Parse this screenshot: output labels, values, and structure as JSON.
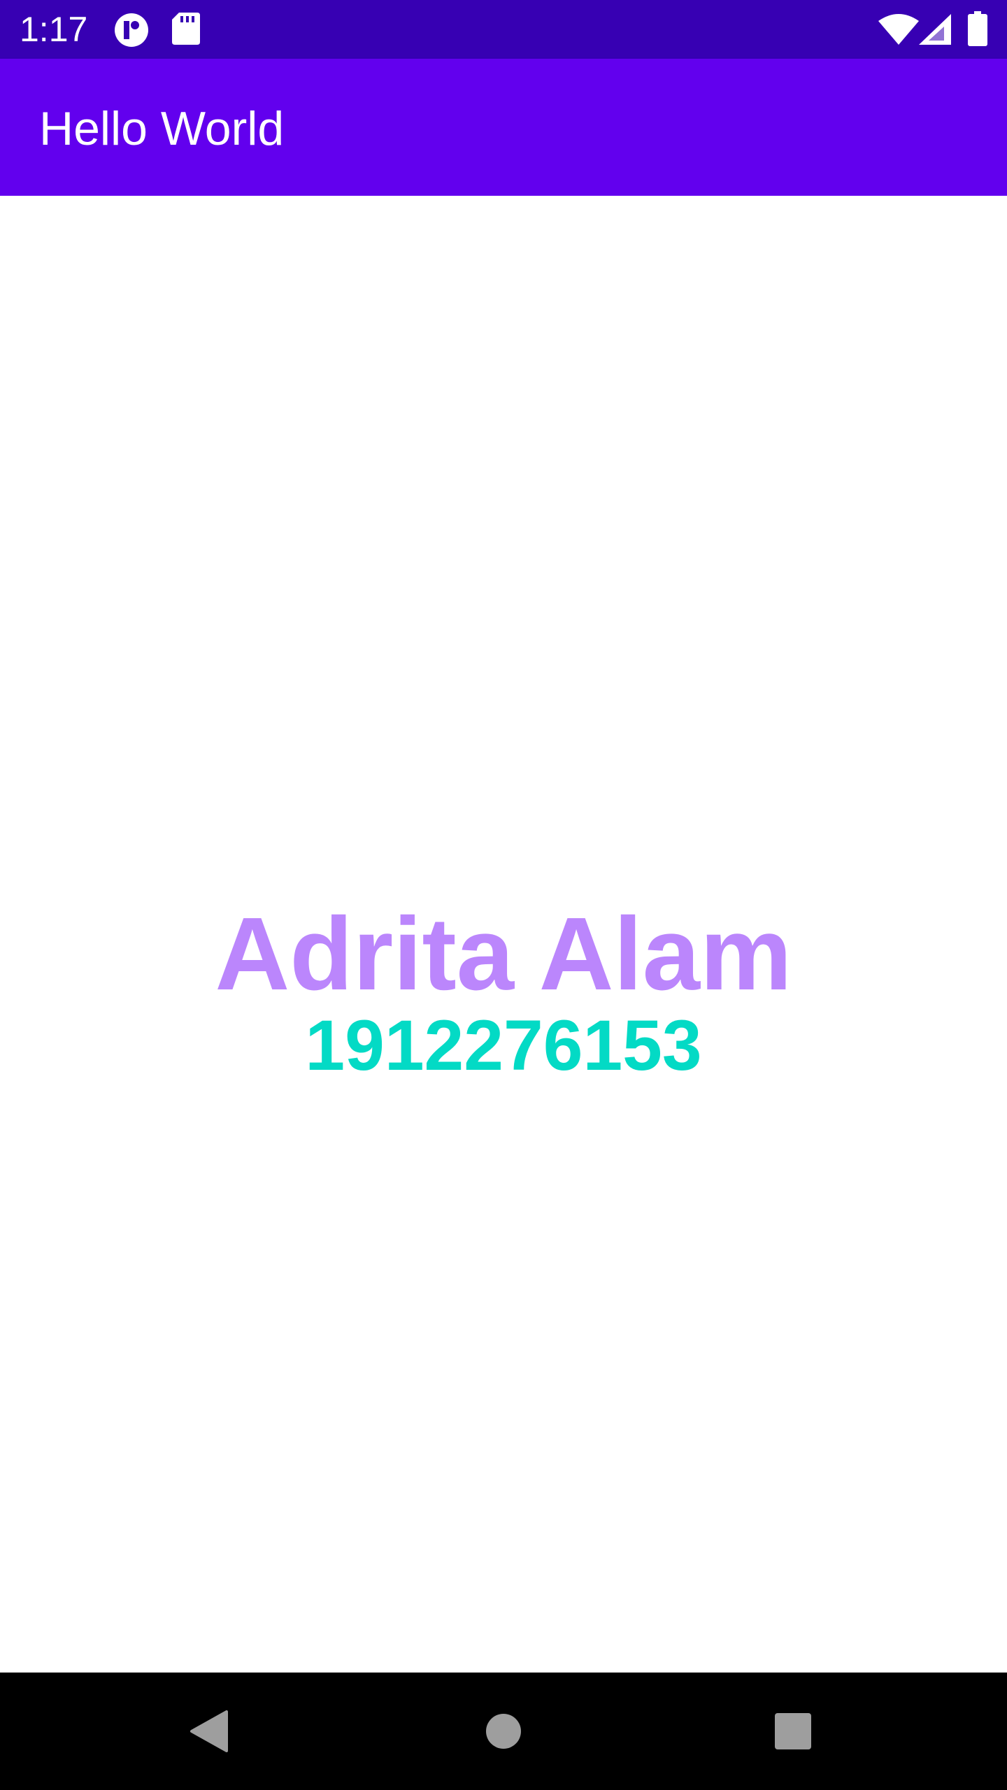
{
  "status_bar": {
    "time": "1:17",
    "background": "#3700b3",
    "icons": [
      "app-notification-icon",
      "sd-card-icon",
      "wifi-icon",
      "cell-signal-icon",
      "battery-icon"
    ]
  },
  "app_bar": {
    "title": "Hello World",
    "background": "#6200ee"
  },
  "main": {
    "name": "Adrita Alam",
    "name_color": "#bb86fc",
    "student_id": "1912276153",
    "id_color": "#03dac5"
  },
  "nav_bar": {
    "buttons": [
      "back-icon",
      "home-icon",
      "recents-icon"
    ]
  }
}
